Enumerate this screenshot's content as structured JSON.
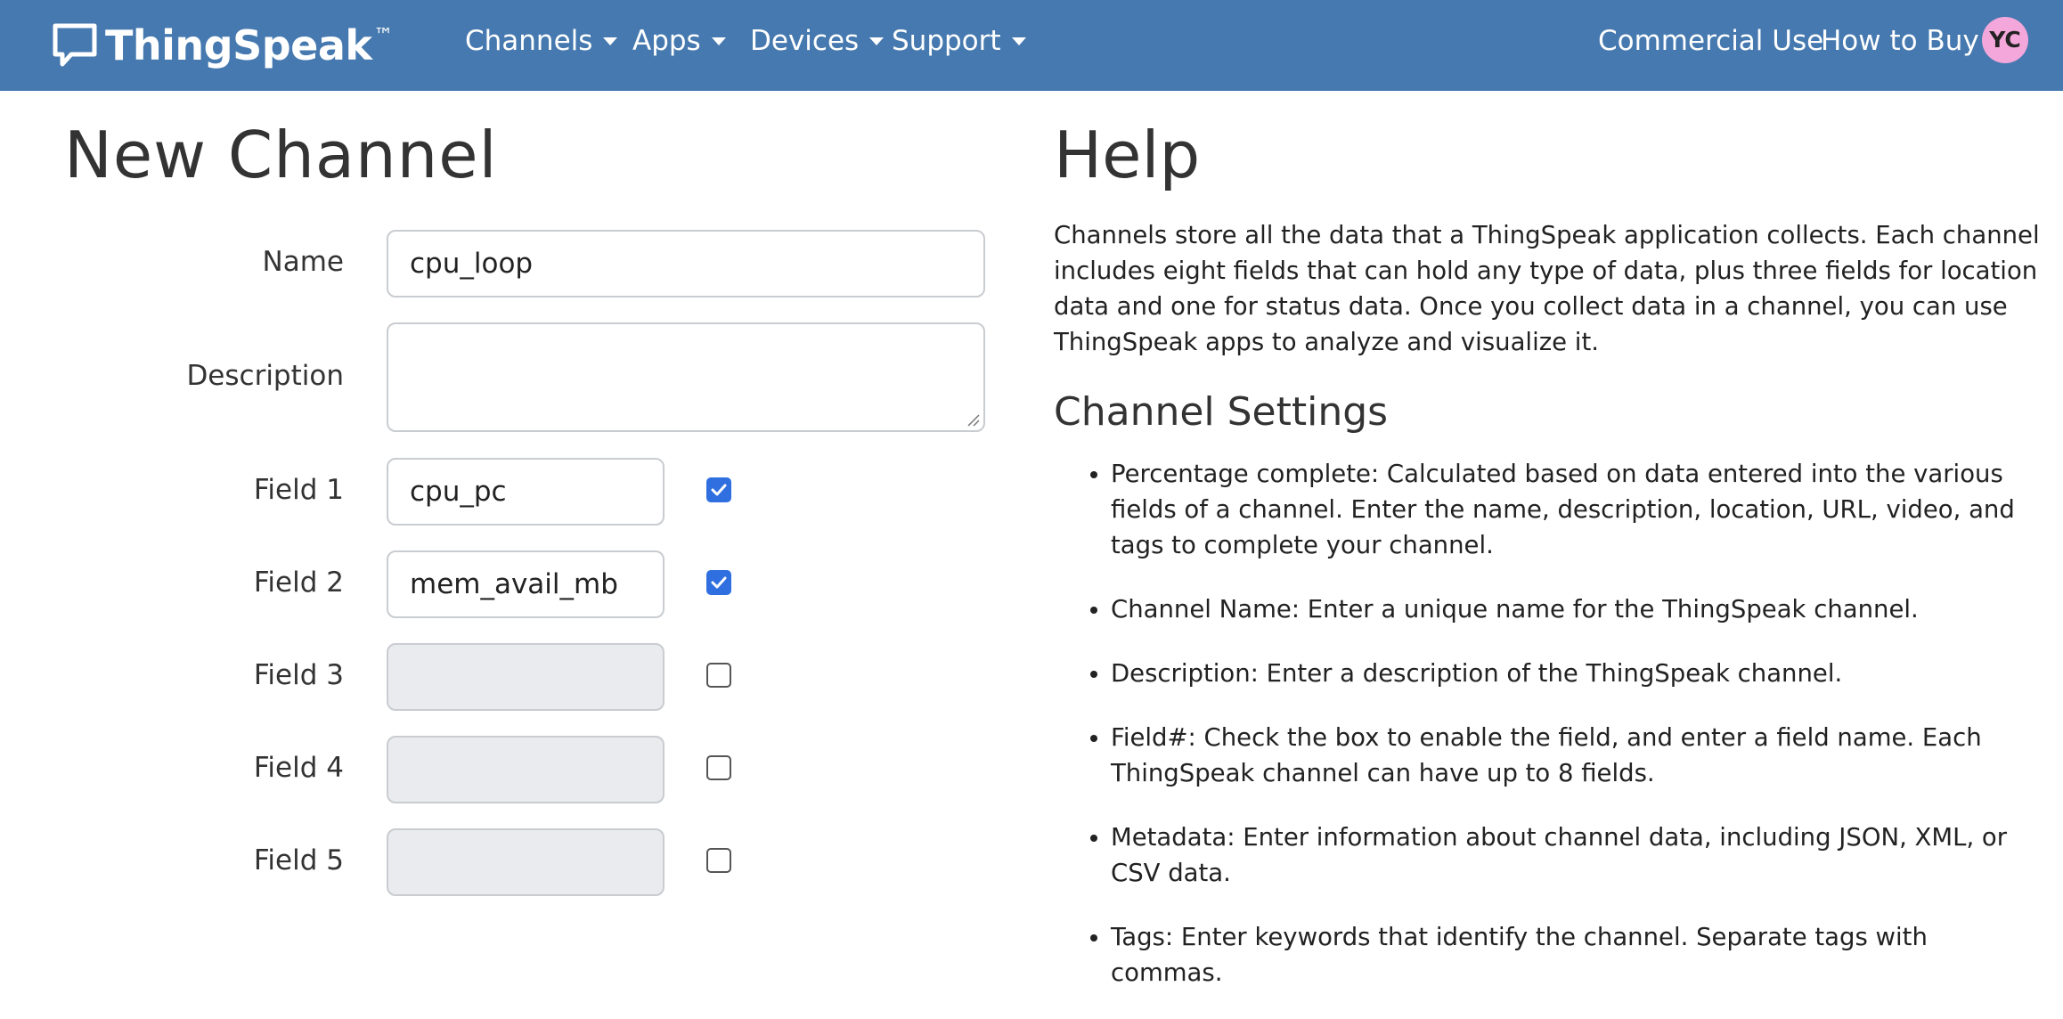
{
  "navbar": {
    "logo_text": "ThingSpeak",
    "logo_tm": "™",
    "menus": [
      {
        "label": "Channels"
      },
      {
        "label": "Apps"
      },
      {
        "label": "Devices"
      },
      {
        "label": "Support"
      }
    ],
    "links": [
      {
        "label": "Commercial Use"
      },
      {
        "label": "How to Buy"
      }
    ],
    "avatar_initials": "YC"
  },
  "form": {
    "title": "New Channel",
    "name_label": "Name",
    "name_value": "cpu_loop",
    "description_label": "Description",
    "description_value": "",
    "fields": [
      {
        "label": "Field 1",
        "value": "cpu_pc",
        "enabled": true
      },
      {
        "label": "Field 2",
        "value": "mem_avail_mb",
        "enabled": true
      },
      {
        "label": "Field 3",
        "value": "",
        "enabled": false
      },
      {
        "label": "Field 4",
        "value": "",
        "enabled": false
      },
      {
        "label": "Field 5",
        "value": "",
        "enabled": false
      }
    ]
  },
  "help": {
    "title": "Help",
    "intro": "Channels store all the data that a ThingSpeak application collects. Each channel includes eight fields that can hold any type of data, plus three fields for location data and one for status data. Once you collect data in a channel, you can use ThingSpeak apps to analyze and visualize it.",
    "section_title": "Channel Settings",
    "items": [
      "Percentage complete: Calculated based on data entered into the various fields of a channel. Enter the name, description, location, URL, video, and tags to complete your channel.",
      "Channel Name: Enter a unique name for the ThingSpeak channel.",
      "Description: Enter a description of the ThingSpeak channel.",
      "Field#: Check the box to enable the field, and enter a field name. Each ThingSpeak channel can have up to 8 fields.",
      "Metadata: Enter information about channel data, including JSON, XML, or CSV data.",
      "Tags: Enter keywords that identify the channel. Separate tags with commas."
    ]
  },
  "colors": {
    "navbar": "#4679af",
    "checkbox_checked": "#2f6fe0",
    "avatar": "#f4a7da",
    "disabled_input": "#e9ebef"
  }
}
